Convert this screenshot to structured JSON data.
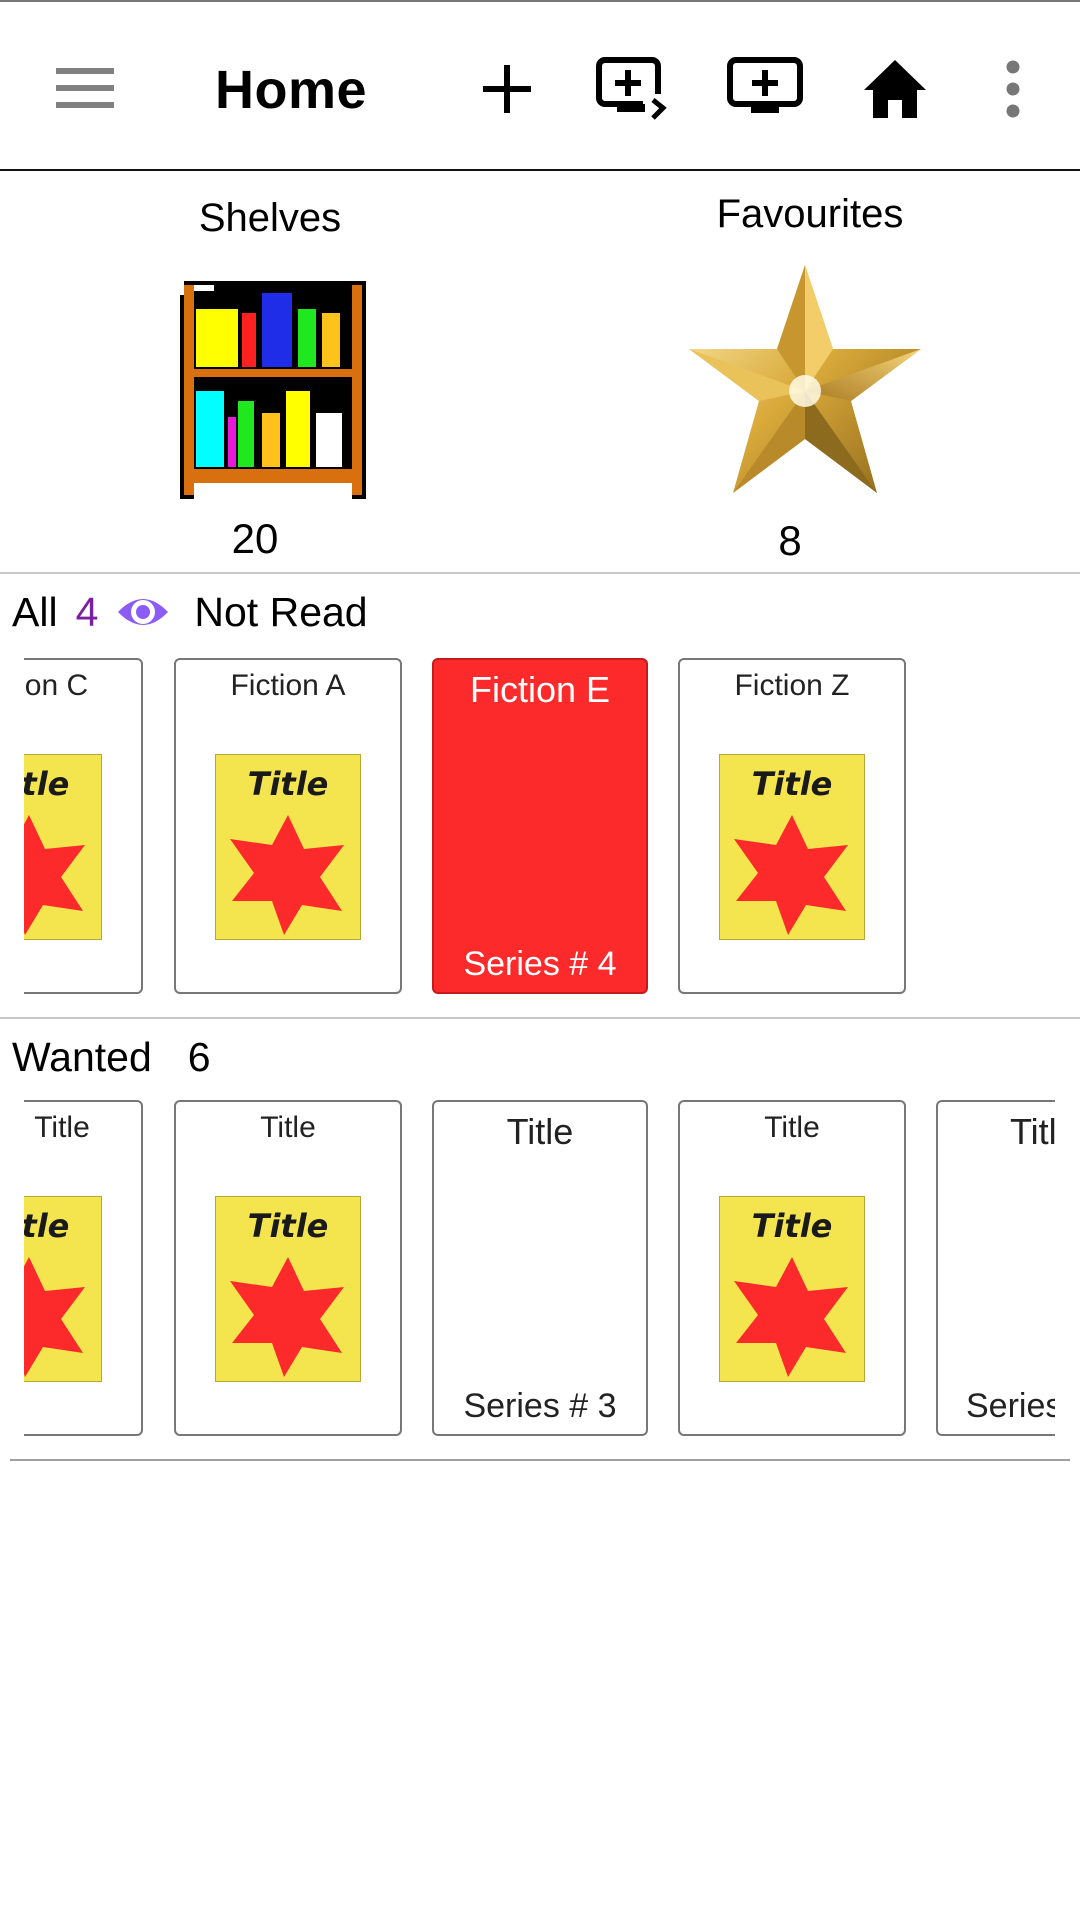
{
  "app_bar": {
    "title": "Home",
    "icons": {
      "menu": "hamburger-menu-icon",
      "add": "plus-icon",
      "add_screen_go": "monitor-plus-arrow-icon",
      "add_screen": "monitor-plus-icon",
      "home": "home-icon",
      "more": "more-vertical-icon"
    }
  },
  "summary": {
    "shelves": {
      "label": "Shelves",
      "count": "20",
      "icon": "bookcase-icon"
    },
    "favourites": {
      "label": "Favourites",
      "count": "8",
      "icon": "gold-star-icon"
    }
  },
  "sections": [
    {
      "label": "All",
      "count": "4",
      "filter_icon": "eye-icon",
      "filter_label": "Not Read",
      "books": [
        {
          "title": "Fiction C",
          "visible_title": "on C",
          "cover": "yellow-star-cover",
          "cover_text": "Title",
          "series": ""
        },
        {
          "title": "Fiction A",
          "visible_title": "Fiction A",
          "cover": "yellow-star-cover",
          "cover_text": "Title",
          "series": ""
        },
        {
          "title": "Fiction E",
          "visible_title": "Fiction E",
          "cover": "none",
          "cover_text": "",
          "series": "Series # 4",
          "highlight_color": "#fc2a2a"
        },
        {
          "title": "Fiction Z",
          "visible_title": "Fiction Z",
          "cover": "yellow-star-cover",
          "cover_text": "Title",
          "series": ""
        }
      ]
    },
    {
      "label": "Wanted",
      "count": "6",
      "books": [
        {
          "title": "Title",
          "visible_title": "tle",
          "cover": "yellow-star-cover",
          "cover_text": "Title",
          "series": ""
        },
        {
          "title": "Title",
          "visible_title": "Title",
          "cover": "yellow-star-cover",
          "cover_text": "Title",
          "series": ""
        },
        {
          "title": "Title",
          "visible_title": "Title",
          "cover": "none",
          "cover_text": "",
          "series": "Series # 3"
        },
        {
          "title": "Title",
          "visible_title": "Title",
          "cover": "yellow-star-cover",
          "cover_text": "Title",
          "series": ""
        },
        {
          "title": "Title",
          "visible_title": "Title",
          "cover": "none",
          "cover_text": "",
          "series": "Series"
        }
      ]
    }
  ],
  "colors": {
    "accent_purple": "#7b1fa2",
    "eye_icon": "#8b5cf6",
    "highlight_red": "#fc2a2a",
    "cover_yellow": "#f4e44e",
    "cover_star_red": "#fc2a2a"
  }
}
